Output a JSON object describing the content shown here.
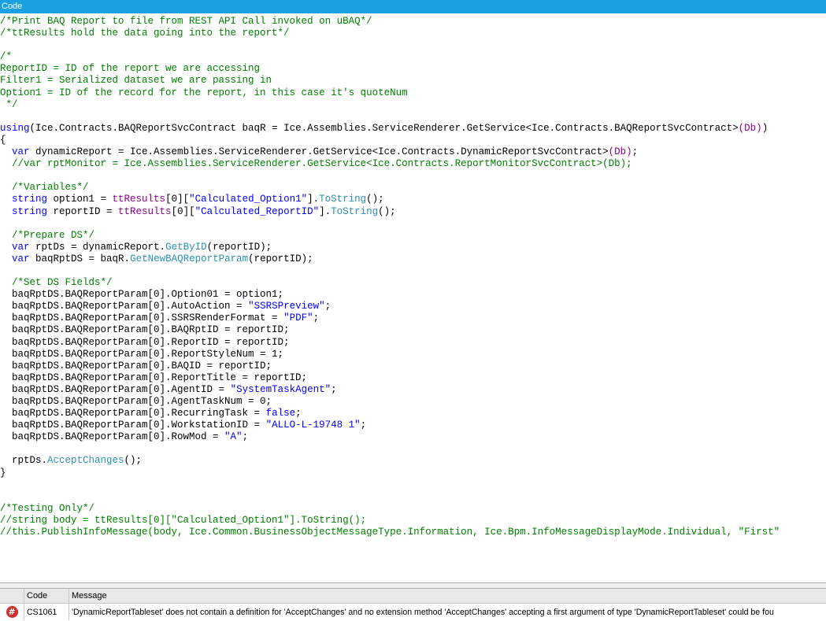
{
  "panel": {
    "title": "Code"
  },
  "code_lines": [
    [
      [
        "c",
        "/*Print BAQ Report to file from REST API Call invoked on uBAQ*/"
      ]
    ],
    [
      [
        "c",
        "/*ttResults hold the data going into the report*/"
      ]
    ],
    [],
    [
      [
        "c",
        "/*"
      ]
    ],
    [
      [
        "c",
        "ReportID = ID of the report we are accessing"
      ]
    ],
    [
      [
        "c",
        "Filter1 = Serialized dataset we are passing in"
      ]
    ],
    [
      [
        "c",
        "Option1 = ID of the record for the report, in this case it's quoteNum"
      ]
    ],
    [
      [
        "c",
        " */"
      ]
    ],
    [],
    [
      [
        "k",
        "using"
      ],
      [
        "t",
        "(Ice.Contracts.BAQReportSvcContract baqR = Ice.Assemblies.ServiceRenderer.GetService<Ice.Contracts.BAQReportSvcContract>"
      ],
      [
        "p",
        "(Db)"
      ],
      [
        "t",
        ")"
      ]
    ],
    [
      [
        "t",
        "{"
      ]
    ],
    [
      [
        "t",
        "  "
      ],
      [
        "k",
        "var"
      ],
      [
        "t",
        " dynamicReport = Ice.Assemblies.ServiceRenderer.GetService<Ice.Contracts.DynamicReportSvcContract>"
      ],
      [
        "p",
        "(Db)"
      ],
      [
        "t",
        ";"
      ]
    ],
    [
      [
        "c",
        "  //var rptMonitor = Ice.Assemblies.ServiceRenderer.GetService<Ice.Contracts.ReportMonitorSvcContract>(Db);"
      ]
    ],
    [],
    [
      [
        "c",
        "  /*Variables*/"
      ]
    ],
    [
      [
        "t",
        "  "
      ],
      [
        "k",
        "string"
      ],
      [
        "t",
        " option1 = "
      ],
      [
        "p",
        "ttResults"
      ],
      [
        "t",
        "[0]["
      ],
      [
        "k",
        "\"Calculated_Option1\""
      ],
      [
        "t",
        "]."
      ],
      [
        "m",
        "ToString"
      ],
      [
        "t",
        "();"
      ]
    ],
    [
      [
        "t",
        "  "
      ],
      [
        "k",
        "string"
      ],
      [
        "t",
        " reportID = "
      ],
      [
        "p",
        "ttResults"
      ],
      [
        "t",
        "[0]["
      ],
      [
        "k",
        "\"Calculated_ReportID\""
      ],
      [
        "t",
        "]."
      ],
      [
        "m",
        "ToString"
      ],
      [
        "t",
        "();"
      ]
    ],
    [],
    [
      [
        "c",
        "  /*Prepare DS*/"
      ]
    ],
    [
      [
        "t",
        "  "
      ],
      [
        "k",
        "var"
      ],
      [
        "t",
        " rptDs = dynamicReport."
      ],
      [
        "m",
        "GetByID"
      ],
      [
        "t",
        "(reportID);"
      ]
    ],
    [
      [
        "t",
        "  "
      ],
      [
        "k",
        "var"
      ],
      [
        "t",
        " baqRptDS = baqR."
      ],
      [
        "m",
        "GetNewBAQReportParam"
      ],
      [
        "t",
        "(reportID);"
      ]
    ],
    [],
    [
      [
        "c",
        "  /*Set DS Fields*/"
      ]
    ],
    [
      [
        "t",
        "  baqRptDS.BAQReportParam[0].Option01 = option1;"
      ]
    ],
    [
      [
        "t",
        "  baqRptDS.BAQReportParam[0].AutoAction = "
      ],
      [
        "k",
        "\"SSRSPreview\""
      ],
      [
        "t",
        ";"
      ]
    ],
    [
      [
        "t",
        "  baqRptDS.BAQReportParam[0].SSRSRenderFormat = "
      ],
      [
        "k",
        "\"PDF\""
      ],
      [
        "t",
        ";"
      ]
    ],
    [
      [
        "t",
        "  baqRptDS.BAQReportParam[0].BAQRptID = reportID;"
      ]
    ],
    [
      [
        "t",
        "  baqRptDS.BAQReportParam[0].ReportID = reportID;"
      ]
    ],
    [
      [
        "t",
        "  baqRptDS.BAQReportParam[0].ReportStyleNum = 1;"
      ]
    ],
    [
      [
        "t",
        "  baqRptDS.BAQReportParam[0].BAQID = reportID;"
      ]
    ],
    [
      [
        "t",
        "  baqRptDS.BAQReportParam[0].ReportTitle = reportID;"
      ]
    ],
    [
      [
        "t",
        "  baqRptDS.BAQReportParam[0].AgentID = "
      ],
      [
        "k",
        "\"SystemTaskAgent\""
      ],
      [
        "t",
        ";"
      ]
    ],
    [
      [
        "t",
        "  baqRptDS.BAQReportParam[0].AgentTaskNum = 0;"
      ]
    ],
    [
      [
        "t",
        "  baqRptDS.BAQReportParam[0].RecurringTask = "
      ],
      [
        "k",
        "false"
      ],
      [
        "t",
        ";"
      ]
    ],
    [
      [
        "t",
        "  baqRptDS.BAQReportParam[0].WorkstationID = "
      ],
      [
        "k",
        "\"ALLO-L-19748 1\""
      ],
      [
        "t",
        ";"
      ]
    ],
    [
      [
        "t",
        "  baqRptDS.BAQReportParam[0].RowMod = "
      ],
      [
        "k",
        "\"A\""
      ],
      [
        "t",
        ";"
      ]
    ],
    [],
    [
      [
        "t",
        "  rptDs."
      ],
      [
        "m",
        "AcceptChanges"
      ],
      [
        "t",
        "();"
      ]
    ],
    [
      [
        "t",
        "}"
      ]
    ],
    [],
    [],
    [
      [
        "c",
        "/*Testing Only*/"
      ]
    ],
    [
      [
        "c",
        "//string body = ttResults[0][\"Calculated_Option1\"].ToString();"
      ]
    ],
    [
      [
        "c",
        "//this.PublishInfoMessage(body, Ice.Common.BusinessObjectMessageType.Information, Ice.Bpm.InfoMessageDisplayMode.Individual, \"First\""
      ]
    ]
  ],
  "error_list": {
    "headers": {
      "code": "Code",
      "message": "Message"
    },
    "rows": [
      {
        "icon": "error-icon",
        "icon_glyph": "#",
        "code": "CS1061",
        "message": "'DynamicReportTableset' does not contain a definition for 'AcceptChanges' and no extension method 'AcceptChanges' accepting a first argument of type 'DynamicReportTableset' could be fou"
      }
    ]
  },
  "colors": {
    "header_bg": "#1ba1e2",
    "comment": "#008000",
    "keyword": "#0000ff",
    "method": "#2b91af",
    "identifier_purple": "#8b008b",
    "error_red": "#d32f2f"
  }
}
